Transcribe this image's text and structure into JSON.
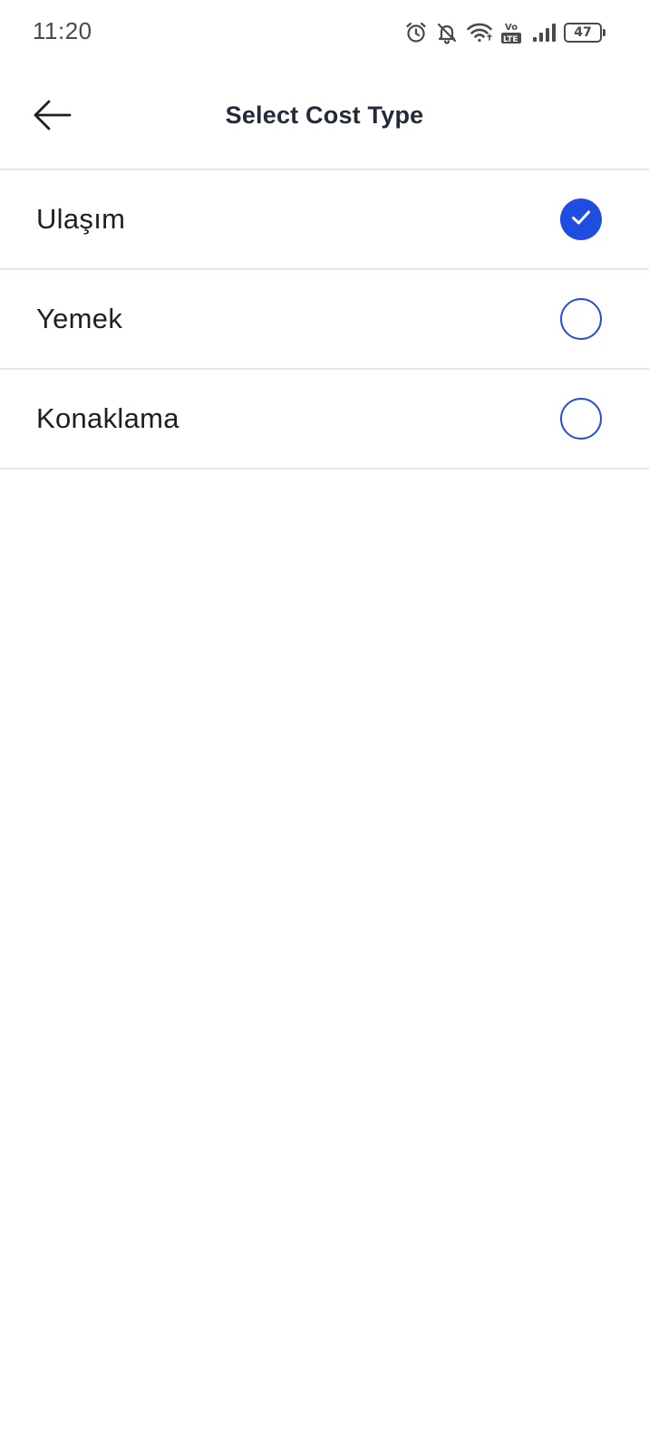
{
  "status_bar": {
    "time": "11:20",
    "icons": [
      "alarm-icon",
      "bell-off-icon",
      "wifi-icon",
      "volte-icon",
      "signal-icon",
      "battery-icon"
    ],
    "volte_label_top": "Vo",
    "volte_label_bottom": "LTE",
    "battery_level": "47"
  },
  "header": {
    "back_icon": "arrow-left-icon",
    "title": "Select Cost Type"
  },
  "options": [
    {
      "label": "Ulaşım",
      "selected": true
    },
    {
      "label": "Yemek",
      "selected": false
    },
    {
      "label": "Konaklama",
      "selected": false
    }
  ],
  "colors": {
    "accent": "#1f4de0",
    "divider": "#e2e6ed",
    "title_text": "#232a38",
    "body_text": "#1c1f26"
  }
}
